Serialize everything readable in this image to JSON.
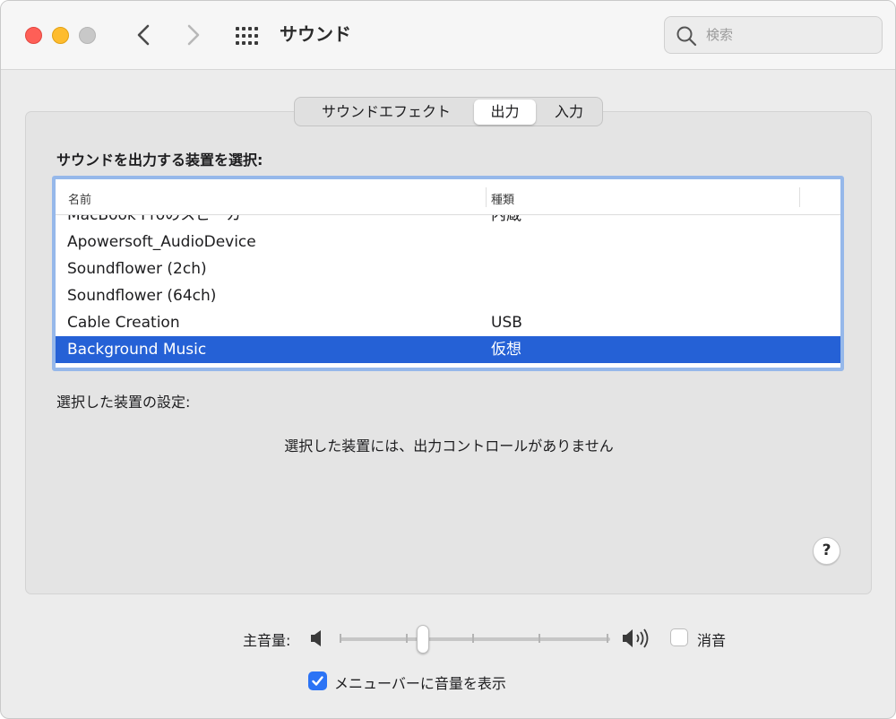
{
  "window": {
    "title": "サウンド",
    "search_placeholder": "検索"
  },
  "tabs": [
    {
      "label": "サウンドエフェクト",
      "selected": false
    },
    {
      "label": "出力",
      "selected": true
    },
    {
      "label": "入力",
      "selected": false
    }
  ],
  "output": {
    "heading": "サウンドを出力する装置を選択:",
    "columns": {
      "name": "名前",
      "type": "種類"
    },
    "devices": [
      {
        "name": "MacBook Proのスピーカ",
        "type": "内蔵"
      },
      {
        "name": "Apowersoft_AudioDevice",
        "type": ""
      },
      {
        "name": "Soundflower (2ch)",
        "type": ""
      },
      {
        "name": "Soundflower (64ch)",
        "type": ""
      },
      {
        "name": "Cable Creation",
        "type": "USB"
      },
      {
        "name": "Background Music",
        "type": "仮想",
        "selected": true
      }
    ],
    "settings_label": "選択した装置の設定:",
    "no_controls_message": "選択した装置には、出力コントロールがありません",
    "help_label": "?"
  },
  "volume": {
    "label": "主音量:",
    "level": 0.3,
    "mute_label": "消音",
    "muted": false
  },
  "menubar": {
    "label": "メニューバーに音量を表示",
    "checked": true
  },
  "colors": {
    "selection": "#2561d6",
    "list_focus_ring": "#96b8ea",
    "checkbox_accent": "#2b73f5"
  }
}
